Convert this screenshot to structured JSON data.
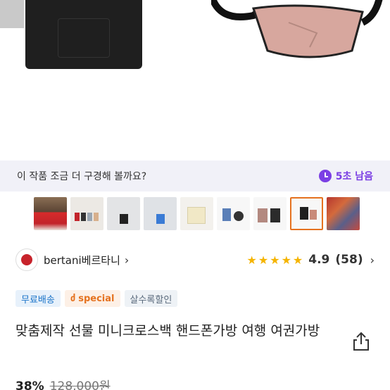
{
  "timer": {
    "message": "이 작품 조금 더 구경해 볼까요?",
    "remaining": "5초 남음"
  },
  "shop": {
    "name": "bertani베르타니",
    "rating": "4.9",
    "review_count": "(58)",
    "stars": 5
  },
  "badges": {
    "free_shipping": "무료배송",
    "special": "special",
    "bulk_discount": "살수록할인"
  },
  "product": {
    "title": "맞춤제작 선물 미니크로스백 핸드폰가방 여행 여권가방",
    "discount": "38%",
    "original_price": "128,000원"
  },
  "colors": {
    "accent_purple": "#7b3fe4",
    "star": "#f5b400",
    "selected_thumb": "#e5721f"
  }
}
